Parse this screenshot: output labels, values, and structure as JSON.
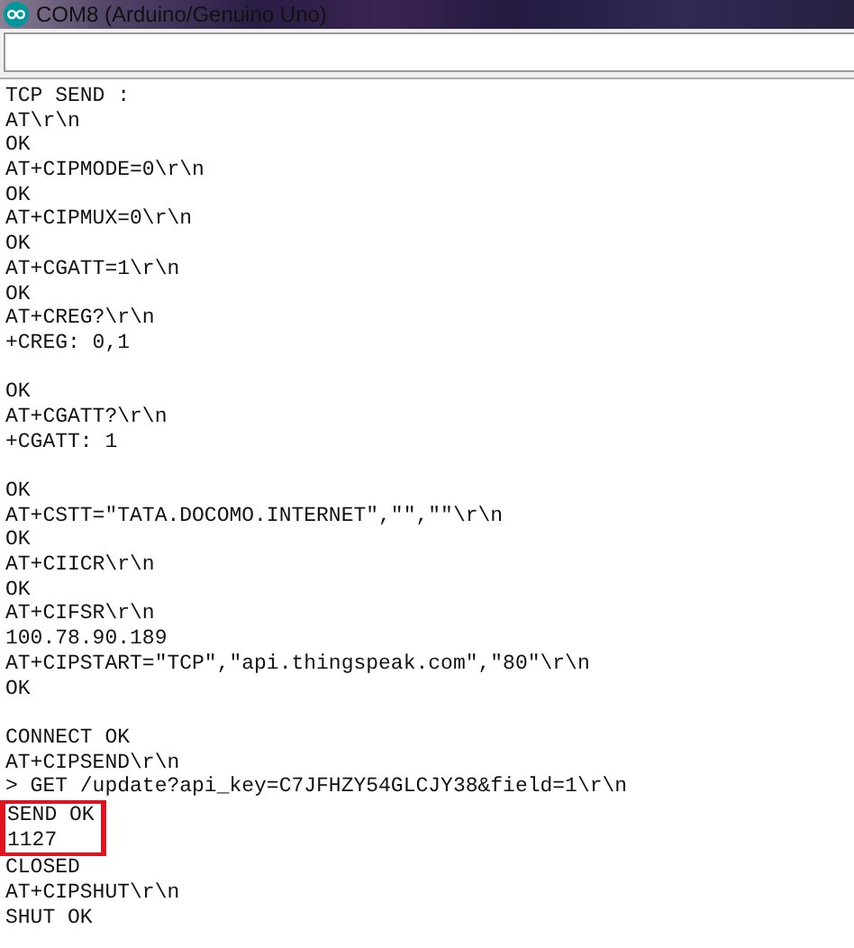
{
  "window": {
    "title": "COM8 (Arduino/Genuino Uno)"
  },
  "output": [
    {
      "kind": "text",
      "text": "TCP SEND :",
      "highlighted": false
    },
    {
      "kind": "text",
      "text": "AT\\r\\n",
      "highlighted": false
    },
    {
      "kind": "text",
      "text": "OK",
      "highlighted": false
    },
    {
      "kind": "text",
      "text": "AT+CIPMODE=0\\r\\n",
      "highlighted": false
    },
    {
      "kind": "text",
      "text": "OK",
      "highlighted": false
    },
    {
      "kind": "text",
      "text": "AT+CIPMUX=0\\r\\n",
      "highlighted": false
    },
    {
      "kind": "text",
      "text": "OK",
      "highlighted": false
    },
    {
      "kind": "text",
      "text": "AT+CGATT=1\\r\\n",
      "highlighted": false
    },
    {
      "kind": "text",
      "text": "OK",
      "highlighted": false
    },
    {
      "kind": "text",
      "text": "AT+CREG?\\r\\n",
      "highlighted": false
    },
    {
      "kind": "text",
      "text": "+CREG: 0,1",
      "highlighted": false
    },
    {
      "kind": "blank"
    },
    {
      "kind": "text",
      "text": "OK",
      "highlighted": false
    },
    {
      "kind": "text",
      "text": "AT+CGATT?\\r\\n",
      "highlighted": false
    },
    {
      "kind": "text",
      "text": "+CGATT: 1",
      "highlighted": false
    },
    {
      "kind": "blank"
    },
    {
      "kind": "text",
      "text": "OK",
      "highlighted": false
    },
    {
      "kind": "text",
      "text": "AT+CSTT=\"TATA.DOCOMO.INTERNET\",\"\",\"\"\\r\\n",
      "highlighted": false
    },
    {
      "kind": "text",
      "text": "OK",
      "highlighted": false
    },
    {
      "kind": "text",
      "text": "AT+CIICR\\r\\n",
      "highlighted": false
    },
    {
      "kind": "text",
      "text": "OK",
      "highlighted": false
    },
    {
      "kind": "text",
      "text": "AT+CIFSR\\r\\n",
      "highlighted": false
    },
    {
      "kind": "text",
      "text": "100.78.90.189",
      "highlighted": false
    },
    {
      "kind": "text",
      "text": "AT+CIPSTART=\"TCP\",\"api.thingspeak.com\",\"80\"\\r\\n",
      "highlighted": false
    },
    {
      "kind": "text",
      "text": "OK",
      "highlighted": false
    },
    {
      "kind": "blank"
    },
    {
      "kind": "text",
      "text": "CONNECT OK",
      "highlighted": false
    },
    {
      "kind": "text",
      "text": "AT+CIPSEND\\r\\n",
      "highlighted": false
    },
    {
      "kind": "text",
      "text": "> GET /update?api_key=C7JFHZY54GLCJY38&field=1\\r\\n",
      "highlighted": false
    },
    {
      "kind": "text",
      "text": "SEND OK",
      "highlighted": true
    },
    {
      "kind": "text",
      "text": "1127",
      "highlighted": true
    },
    {
      "kind": "text",
      "text": "CLOSED",
      "highlighted": false
    },
    {
      "kind": "text",
      "text": "AT+CIPSHUT\\r\\n",
      "highlighted": false
    },
    {
      "kind": "text",
      "text": "SHUT OK",
      "highlighted": false
    }
  ]
}
